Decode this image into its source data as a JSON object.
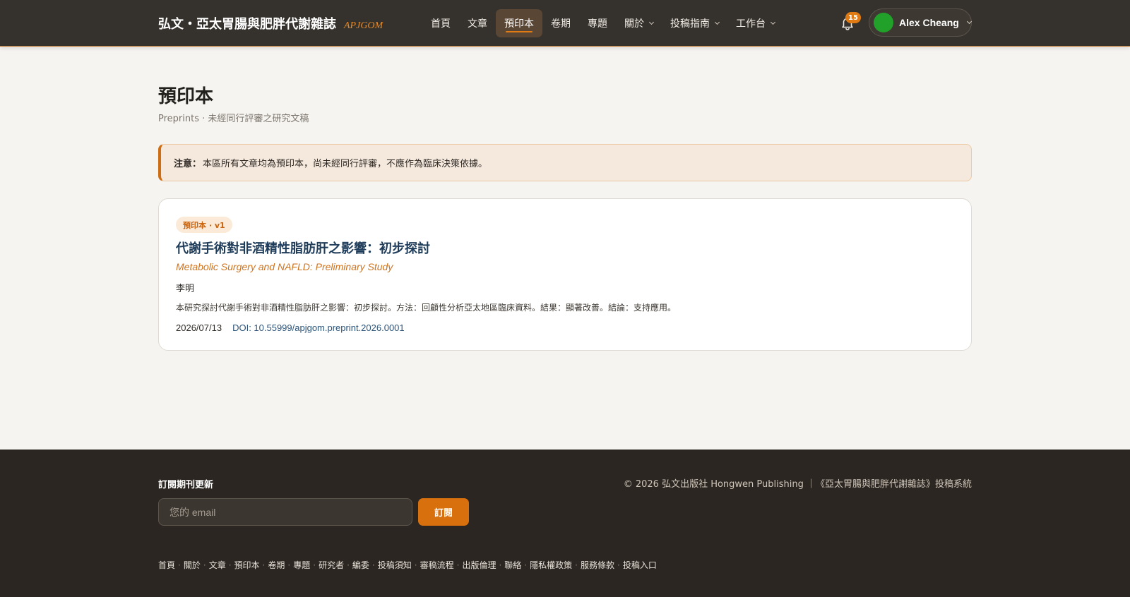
{
  "header": {
    "brand_name": "弘文・亞太胃腸與肥胖代謝雜誌",
    "brand_abbr": "APJGOM",
    "nav": [
      {
        "label": "首頁"
      },
      {
        "label": "文章"
      },
      {
        "label": "預印本",
        "active": true
      },
      {
        "label": "卷期"
      },
      {
        "label": "專題"
      },
      {
        "label": "關於",
        "dropdown": true
      },
      {
        "label": "投稿指南",
        "dropdown": true
      },
      {
        "label": "工作台",
        "dropdown": true
      }
    ],
    "notification_count": "15",
    "user_name": "Alex Cheang",
    "icons": {
      "bell": "bell-icon",
      "chevron": "chevron-down-icon"
    }
  },
  "page": {
    "title": "預印本",
    "subtitle": "Preprints · 未經同行評審之研究文稿"
  },
  "notice": {
    "label": "注意：",
    "text": "本區所有文章均為預印本，尚未經同行評審，不應作為臨床決策依據。"
  },
  "articles": [
    {
      "badge": "預印本 · v1",
      "title": "代謝手術對非酒精性脂肪肝之影響：初步探討",
      "title_en": "Metabolic Surgery and NAFLD: Preliminary Study",
      "author": "李明",
      "abstract": "本研究探討代謝手術對非酒精性脂肪肝之影響：初步探討。方法：回顧性分析亞太地區臨床資料。結果：顯著改善。結論：支持應用。",
      "date": "2026/07/13",
      "doi": "DOI: 10.55999/apjgom.preprint.2026.0001"
    }
  ],
  "footer": {
    "subscribe_title": "訂閱期刊更新",
    "email_placeholder": "您的 email",
    "subscribe_button": "訂閱",
    "copyright": "© 2026 弘文出版社 Hongwen Publishing ｜《亞太胃腸與肥胖代謝雜誌》投稿系統",
    "links": [
      "首頁",
      "關於",
      "文章",
      "預印本",
      "卷期",
      "專題",
      "研究者",
      "編委",
      "投稿須知",
      "審稿流程",
      "出版倫理",
      "聯絡",
      "隱私權政策",
      "服務條款",
      "投稿入口"
    ]
  },
  "colors": {
    "nav_bg": "#35312c",
    "accent": "#e07b14",
    "page_bg": "#f6f4f0",
    "footer_bg": "#2b2621",
    "title_blue": "#1f3d5a"
  }
}
